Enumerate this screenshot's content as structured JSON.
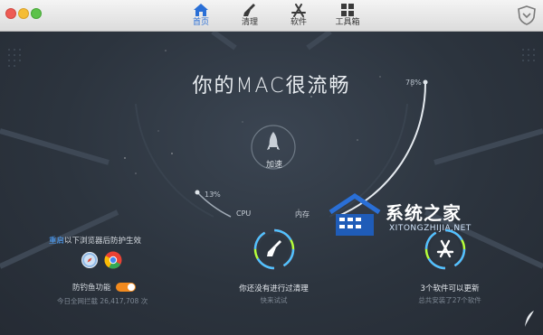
{
  "nav": {
    "items": [
      {
        "label": "首页",
        "icon": "home-icon",
        "active": true
      },
      {
        "label": "清理",
        "icon": "broom-icon",
        "active": false
      },
      {
        "label": "软件",
        "icon": "app-store-icon",
        "active": false
      },
      {
        "label": "工具箱",
        "icon": "toolbox-icon",
        "active": false
      }
    ]
  },
  "main": {
    "headline": "你的MAC很流畅",
    "memory_percent": "78%",
    "cpu_percent": "13%",
    "cpu_label": "CPU",
    "memory_label": "内存",
    "boost_label": "加速"
  },
  "browser_protection": {
    "note_link": "重启",
    "note_rest": "以下浏览器后防护生效",
    "browsers": [
      "safari-icon",
      "chrome-icon"
    ],
    "fishing_label": "防钓鱼功能",
    "fishing_enabled": true,
    "blocked_text": "今日全网拦截 26,417,708 次"
  },
  "cleanup": {
    "title": "你还没有进行过清理",
    "sub": "快来试试"
  },
  "software": {
    "title": "3个软件可以更新",
    "sub": "总共安装了27个软件"
  },
  "watermark": {
    "text": "系统之家",
    "url": "XITONGZHIJIA.NET"
  },
  "colors": {
    "accent": "#2a6fd6",
    "toggle_on": "#f28a1e",
    "link": "#4fa3ff",
    "background": "#2c343e"
  }
}
